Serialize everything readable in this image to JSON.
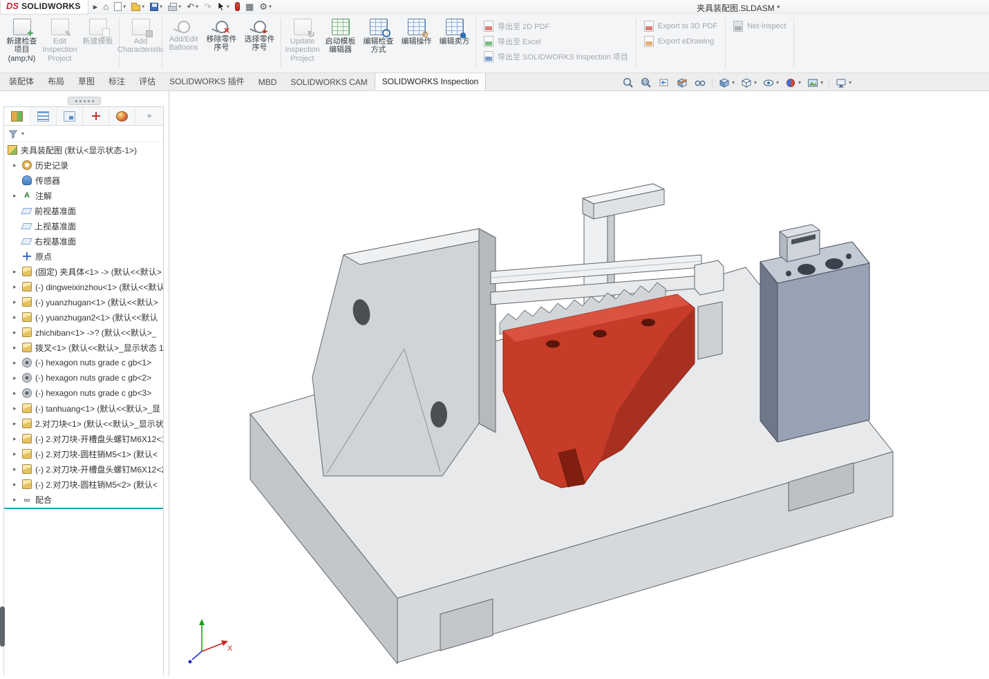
{
  "titlebar": {
    "logo_mark": "DS",
    "logo_text": "SOLIDWORKS",
    "document_title": "夹具装配图.SLDASM *",
    "icon_names": [
      "app-menu-arrow",
      "home-icon",
      "new-document-icon",
      "open-icon",
      "save-icon",
      "print-icon",
      "undo-icon",
      "redo-icon",
      "select-cursor-icon",
      "rebuild-icon",
      "table-icon",
      "options-gear-icon"
    ]
  },
  "glyphs": {
    "menu_arrow": "▸",
    "caret": "▾",
    "home": "⌂",
    "undo": "↶",
    "redo": "↷",
    "table": "▦",
    "gear": "⚙",
    "overflow": "»",
    "expand_arrow": "▸",
    "letter_a": "A",
    "infinity": "∞"
  },
  "ribbon": {
    "buttons": [
      {
        "icon": "new-inspection-project-icon",
        "label": "新建检查项目 (amp;N)",
        "enabled": true
      },
      {
        "icon": "edit-inspection-project-icon",
        "label": "Edit Inspection Project",
        "enabled": false
      },
      {
        "icon": "new-template-icon",
        "label": "新建模板",
        "enabled": false
      },
      {
        "icon": "add-characteristic-icon",
        "label": "Add Characteristic",
        "enabled": false
      },
      {
        "icon": "add-edit-balloons-icon",
        "label": "Add/Edit Balloons",
        "enabled": false
      },
      {
        "icon": "remove-balloons-icon",
        "label": "移除零件序号",
        "enabled": true
      },
      {
        "icon": "select-balloons-icon",
        "label": "选择零件序号",
        "enabled": true
      },
      {
        "icon": "update-inspection-project-icon",
        "label": "Update Inspection Project",
        "enabled": false
      },
      {
        "icon": "launch-template-editor-icon",
        "label": "启动模板编辑器",
        "enabled": true
      },
      {
        "icon": "edit-inspection-method-icon",
        "label": "编辑检查方式",
        "enabled": true
      },
      {
        "icon": "edit-operation-icon",
        "label": "编辑操作",
        "enabled": true
      },
      {
        "icon": "edit-vendor-icon",
        "label": "编辑卖方",
        "enabled": true
      }
    ],
    "export_buttons": [
      {
        "icon": "export-2d-pdf-icon",
        "label": "导出至 2D PDF",
        "enabled": false
      },
      {
        "icon": "export-excel-icon",
        "label": "导出至 Excel",
        "enabled": false
      },
      {
        "icon": "export-inspection-project-icon",
        "label": "导出至 SOLIDWORKS Inspection 项目",
        "enabled": false
      },
      {
        "icon": "export-3d-pdf-icon",
        "label": "Export to 3D PDF",
        "enabled": false
      },
      {
        "icon": "export-edrawing-icon",
        "label": "Export eDrawing",
        "enabled": false
      },
      {
        "icon": "net-inspect-icon",
        "label": "Net-Inspect",
        "enabled": false
      }
    ]
  },
  "command_tabs": [
    {
      "label": "装配体",
      "active": false
    },
    {
      "label": "布局",
      "active": false
    },
    {
      "label": "草图",
      "active": false
    },
    {
      "label": "标注",
      "active": false
    },
    {
      "label": "评估",
      "active": false
    },
    {
      "label": "SOLIDWORKS 插件",
      "active": false
    },
    {
      "label": "MBD",
      "active": false
    },
    {
      "label": "SOLIDWORKS CAM",
      "active": false
    },
    {
      "label": "SOLIDWORKS Inspection",
      "active": true
    }
  ],
  "hud_icon_names": [
    "zoom-fit-icon",
    "zoom-area-icon",
    "previous-view-icon",
    "section-view-icon",
    "dynamic-annotation-views-icon",
    "view-orientation-icon",
    "display-style-icon",
    "hide-show-items-icon",
    "edit-appearance-icon",
    "apply-scene-icon",
    "view-settings-icon"
  ],
  "panel": {
    "tab_icon_names": [
      "featuremanager-tab",
      "propertymanager-tab",
      "configurationmanager-tab",
      "dimxpertmanager-tab",
      "displaymanager-tab"
    ],
    "root_label": "夹具装配图 (默认<显示状态-1>)",
    "items": [
      {
        "icon": "history-folder-icon",
        "label": "历史记录"
      },
      {
        "icon": "sensors-folder-icon",
        "label": "传感器"
      },
      {
        "icon": "annotations-folder-icon",
        "label": "注解"
      },
      {
        "icon": "plane-icon",
        "label": "前视基准面"
      },
      {
        "icon": "plane-icon",
        "label": "上视基准面"
      },
      {
        "icon": "plane-icon",
        "label": "右视基准面"
      },
      {
        "icon": "origin-icon",
        "label": "原点"
      },
      {
        "icon": "part-icon",
        "label": "(固定) 夹具体<1> -> (默认<<默认>"
      },
      {
        "icon": "part-icon",
        "label": "(-) dingweixinzhou<1> (默认<<默认>"
      },
      {
        "icon": "part-icon",
        "label": "(-) yuanzhugan<1> (默认<<默认>"
      },
      {
        "icon": "part-icon",
        "label": "(-) yuanzhugan2<1> (默认<<默认"
      },
      {
        "icon": "part-icon",
        "label": "zhichiban<1> ->? (默认<<默认>_"
      },
      {
        "icon": "part-icon",
        "label": "拨叉<1> (默认<<默认>_显示状态 1"
      },
      {
        "icon": "fastener-icon",
        "label": "(-) hexagon nuts grade c gb<1>"
      },
      {
        "icon": "fastener-icon",
        "label": "(-) hexagon nuts grade c gb<2>"
      },
      {
        "icon": "fastener-icon",
        "label": "(-) hexagon nuts grade c gb<3>"
      },
      {
        "icon": "part-icon",
        "label": "(-) tanhuang<1> (默认<<默认>_显"
      },
      {
        "icon": "part-icon",
        "label": "2.对刀块<1> (默认<<默认>_显示状"
      },
      {
        "icon": "part-icon",
        "label": "(-) 2.对刀块-开槽盘头螺钉M6X12<1"
      },
      {
        "icon": "part-icon",
        "label": "(-) 2.对刀块-圆柱销M5<1> (默认<"
      },
      {
        "icon": "part-icon",
        "label": "(-) 2.对刀块-开槽盘头螺钉M6X12<2"
      },
      {
        "icon": "part-icon",
        "label": "(-) 2.对刀块-圆柱销M5<2> (默认<"
      },
      {
        "icon": "mates-folder-icon",
        "label": "配合"
      }
    ]
  },
  "viewport": {
    "triad_x_label": "X",
    "model_part_colors": {
      "base_gray": "#d6d9dc",
      "clamp_red": "#c63c28",
      "tool_block_blue_gray": "#98a2b4"
    }
  }
}
